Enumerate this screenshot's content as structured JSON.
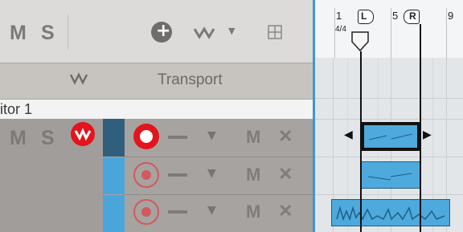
{
  "toolbar": {
    "mute_label": "M",
    "solo_label": "S",
    "add_icon": "plus-circle-icon",
    "automation_icon": "automation-curve-icon",
    "grid_icon": "grid-icon"
  },
  "header": {
    "automation_icon": "automation-curve-icon",
    "transport_label": "Transport"
  },
  "track_name": "itor 1",
  "tracks": [
    {
      "mute": "M",
      "solo": "S",
      "x_label": "✕"
    },
    {
      "mute": "M",
      "x_label": "✕"
    },
    {
      "mute": "M",
      "x_label": "✕"
    }
  ],
  "timeline": {
    "bar_1": "1",
    "bar_5": "5",
    "bar_9": "9",
    "time_sig": "4/4",
    "loop_left_marker": "L",
    "loop_right_marker": "R"
  },
  "colors": {
    "accent_red": "#e3141d",
    "clip_blue": "#4ea9dc",
    "selected_track": "#4aa5da",
    "panel_bg": "#a7a3a0"
  }
}
